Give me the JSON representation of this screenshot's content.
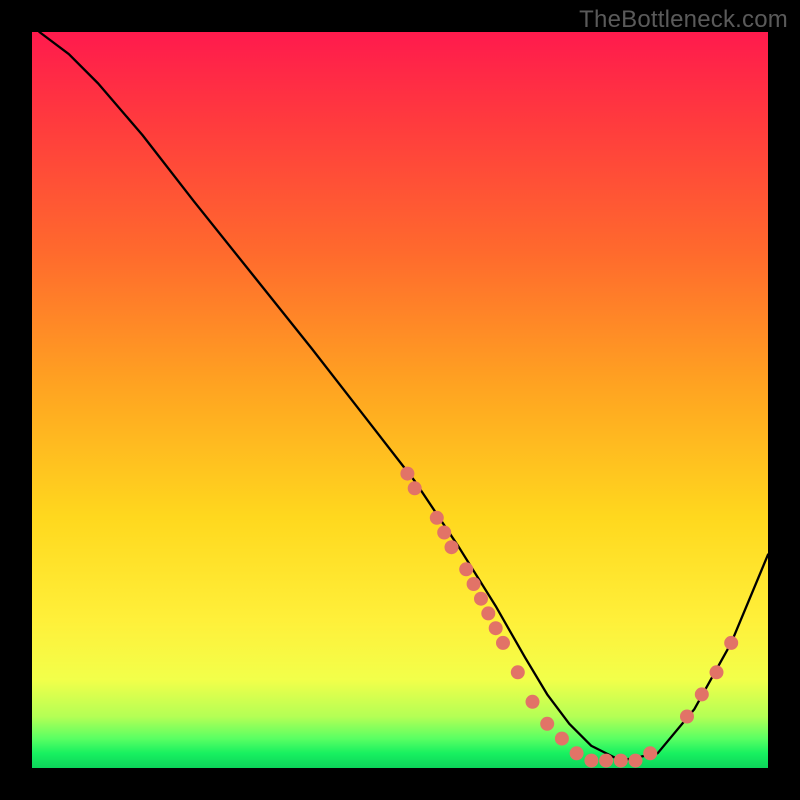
{
  "watermark": "TheBottleneck.com",
  "chart_data": {
    "type": "line",
    "title": "",
    "xlabel": "",
    "ylabel": "",
    "xlim": [
      0,
      100
    ],
    "ylim": [
      0,
      100
    ],
    "series": [
      {
        "name": "curve",
        "x": [
          1,
          5,
          9,
          15,
          22,
          30,
          38,
          45,
          52,
          58,
          63,
          67,
          70,
          73,
          76,
          80,
          85,
          90,
          95,
          100
        ],
        "y": [
          100,
          97,
          93,
          86,
          77,
          67,
          57,
          48,
          39,
          30,
          22,
          15,
          10,
          6,
          3,
          1,
          2,
          8,
          17,
          29
        ]
      }
    ],
    "points": [
      {
        "name": "p1",
        "x": 51,
        "y": 40
      },
      {
        "name": "p2",
        "x": 52,
        "y": 38
      },
      {
        "name": "p3",
        "x": 55,
        "y": 34
      },
      {
        "name": "p4",
        "x": 56,
        "y": 32
      },
      {
        "name": "p5",
        "x": 57,
        "y": 30
      },
      {
        "name": "p6",
        "x": 59,
        "y": 27
      },
      {
        "name": "p7",
        "x": 60,
        "y": 25
      },
      {
        "name": "p8",
        "x": 61,
        "y": 23
      },
      {
        "name": "p9",
        "x": 62,
        "y": 21
      },
      {
        "name": "p10",
        "x": 63,
        "y": 19
      },
      {
        "name": "p11",
        "x": 64,
        "y": 17
      },
      {
        "name": "p12",
        "x": 66,
        "y": 13
      },
      {
        "name": "p13",
        "x": 68,
        "y": 9
      },
      {
        "name": "p14",
        "x": 70,
        "y": 6
      },
      {
        "name": "p15",
        "x": 72,
        "y": 4
      },
      {
        "name": "p16",
        "x": 74,
        "y": 2
      },
      {
        "name": "p17",
        "x": 76,
        "y": 1
      },
      {
        "name": "p18",
        "x": 78,
        "y": 1
      },
      {
        "name": "p19",
        "x": 80,
        "y": 1
      },
      {
        "name": "p20",
        "x": 82,
        "y": 1
      },
      {
        "name": "p21",
        "x": 84,
        "y": 2
      },
      {
        "name": "p22",
        "x": 89,
        "y": 7
      },
      {
        "name": "p23",
        "x": 91,
        "y": 10
      },
      {
        "name": "p24",
        "x": 93,
        "y": 13
      },
      {
        "name": "p25",
        "x": 95,
        "y": 17
      }
    ],
    "point_color": "#e27367",
    "curve_color": "#000000"
  }
}
